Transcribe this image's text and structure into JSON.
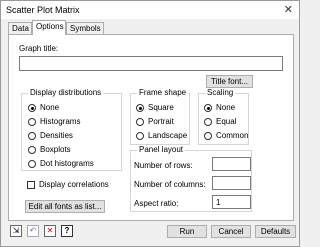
{
  "window": {
    "title": "Scatter Plot Matrix",
    "close_glyph": "✕"
  },
  "tabs": [
    {
      "label": "Data"
    },
    {
      "label": "Options"
    },
    {
      "label": "Symbols"
    }
  ],
  "graph_title": {
    "label": "Graph title:",
    "value": ""
  },
  "title_font_button": "Title font...",
  "display_distributions": {
    "label": "Display distributions",
    "options": [
      "None",
      "Histograms",
      "Densities",
      "Boxplots",
      "Dot histograms"
    ],
    "selected": "None"
  },
  "frame_shape": {
    "label": "Frame shape",
    "options": [
      "Square",
      "Portrait",
      "Landscape"
    ],
    "selected": "Square"
  },
  "scaling": {
    "label": "Scaling",
    "options": [
      "None",
      "Equal",
      "Common"
    ],
    "selected": "None"
  },
  "display_correlations": {
    "label": "Display correlations",
    "checked": false
  },
  "panel_layout": {
    "label": "Panel layout",
    "rows_label": "Number of rows:",
    "rows_value": "",
    "columns_label": "Number of columns:",
    "columns_value": "",
    "aspect_label": "Aspect ratio:",
    "aspect_value": "1"
  },
  "edit_fonts_button": "Edit all fonts as list...",
  "footer": {
    "run": "Run",
    "cancel": "Cancel",
    "defaults": "Defaults",
    "icons": [
      "pin-icon",
      "undo-icon",
      "clear-icon",
      "help-icon"
    ],
    "help_glyph": "?",
    "clear_glyph": "✕",
    "undo_glyph": "↶",
    "pin_glyph": "⇲"
  }
}
